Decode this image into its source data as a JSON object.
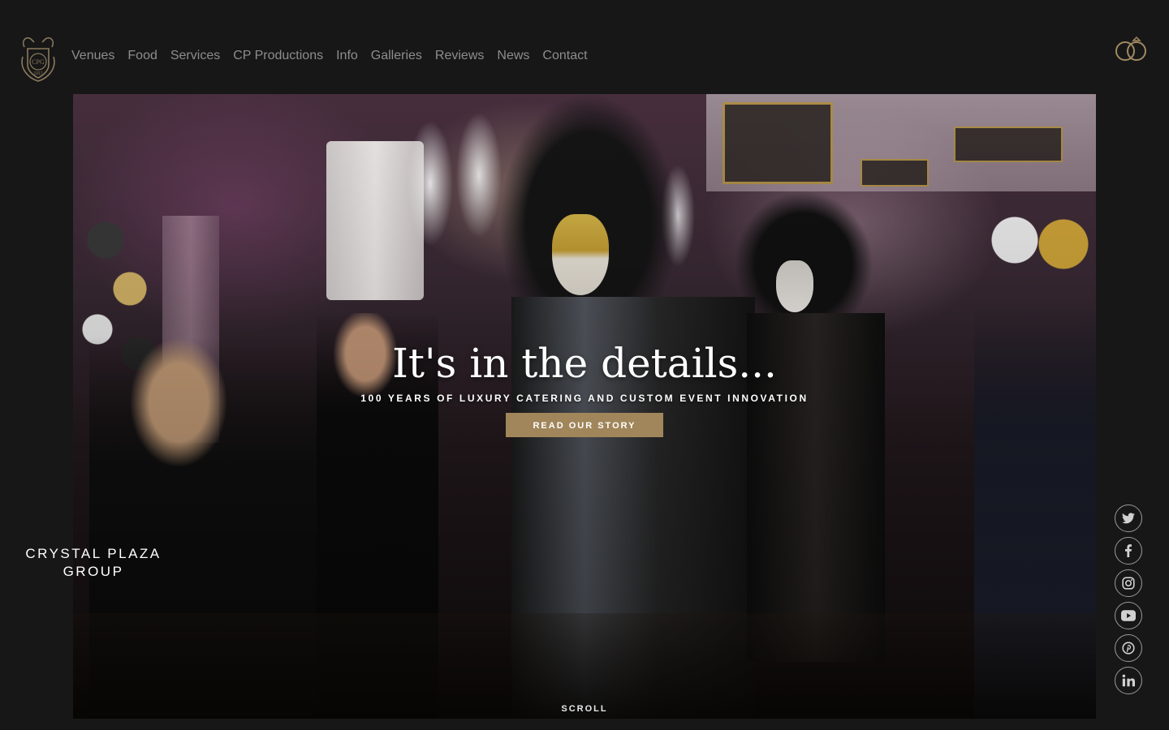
{
  "header": {
    "logo": {
      "text": "CPG",
      "year": "1917",
      "icon": "crest-logo-icon"
    },
    "nav": [
      {
        "label": "Venues"
      },
      {
        "label": "Food"
      },
      {
        "label": "Services"
      },
      {
        "label": "CP Productions"
      },
      {
        "label": "Info"
      },
      {
        "label": "Galleries"
      },
      {
        "label": "Reviews"
      },
      {
        "label": "News"
      },
      {
        "label": "Contact"
      }
    ],
    "rings_icon": "wedding-rings-icon"
  },
  "hero": {
    "title": "It's in the details...",
    "subtitle": "100 YEARS OF LUXURY CATERING AND CUSTOM EVENT INNOVATION",
    "button_label": "READ OUR STORY",
    "scroll_label": "SCROLL"
  },
  "brand": {
    "line1": "CRYSTAL PLAZA",
    "line2": "GROUP"
  },
  "social": [
    {
      "icon": "twitter-icon"
    },
    {
      "icon": "facebook-icon"
    },
    {
      "icon": "instagram-icon"
    },
    {
      "icon": "youtube-icon"
    },
    {
      "icon": "pinterest-icon"
    },
    {
      "icon": "linkedin-icon"
    }
  ],
  "colors": {
    "background": "#171717",
    "nav_text": "#8d8d8d",
    "accent_gold": "#a0865a",
    "text_white": "#ffffff"
  }
}
